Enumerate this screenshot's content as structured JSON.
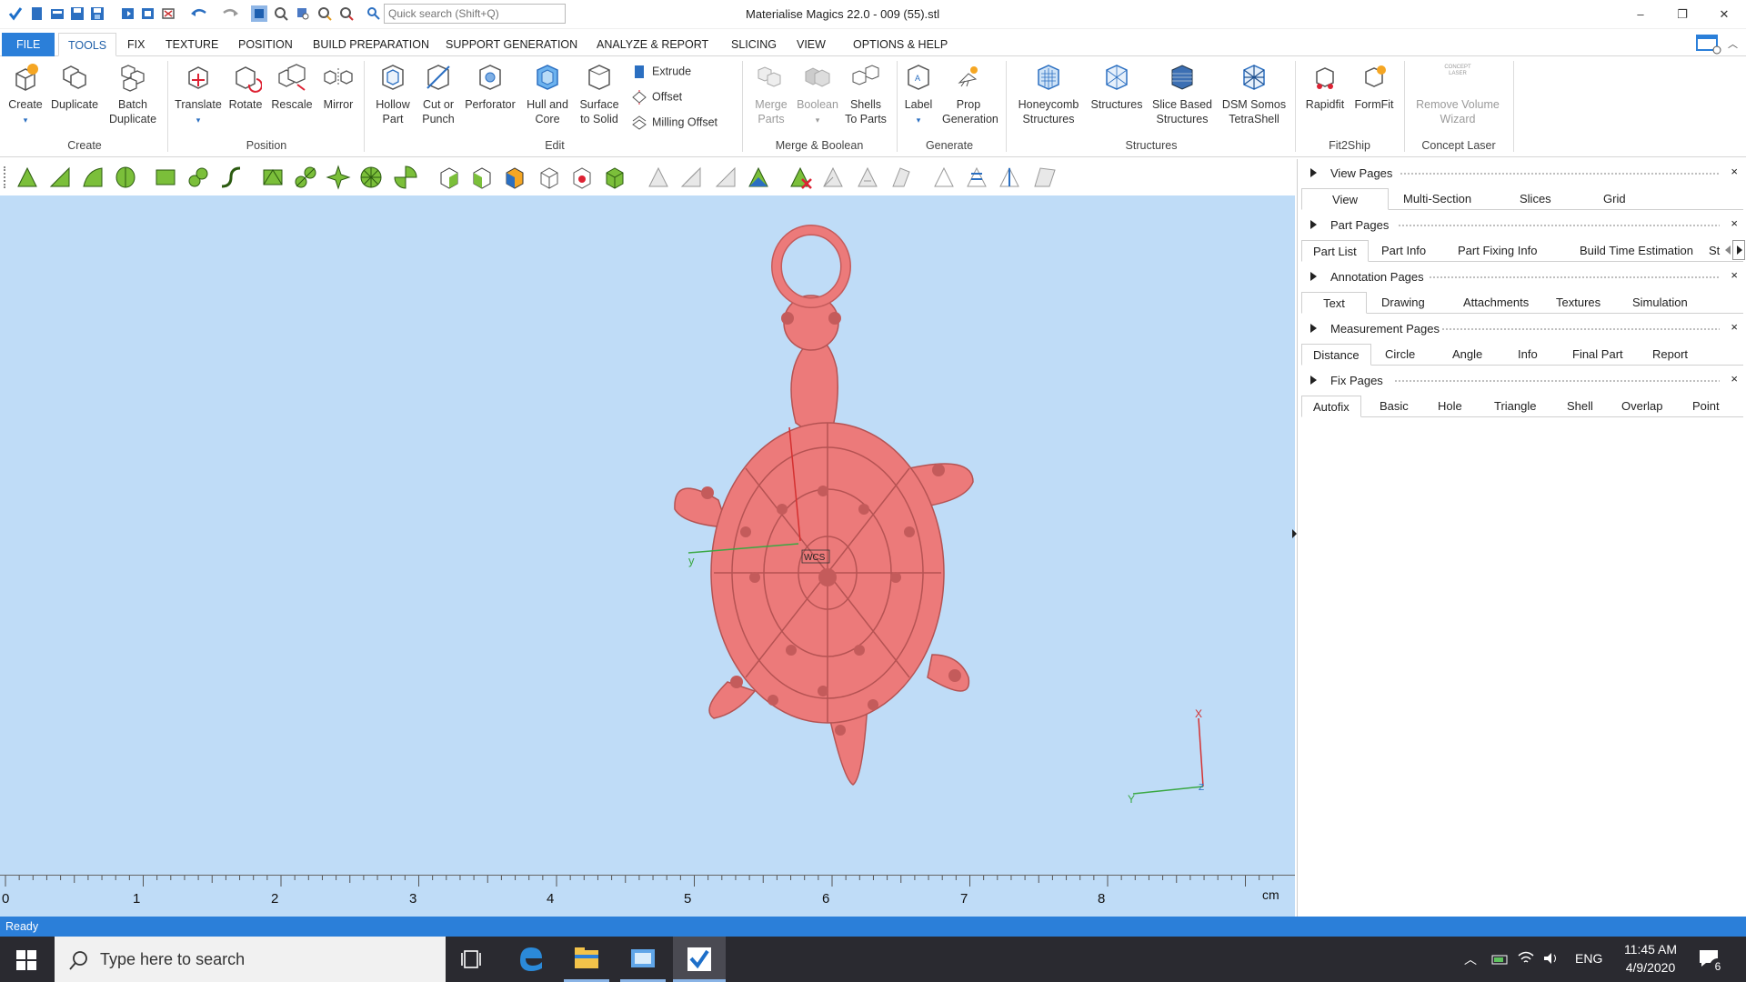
{
  "titlebar": {
    "quick_search_placeholder": "Quick search (Shift+Q)",
    "window_title": "Materialise Magics 22.0 - 009 (55).stl",
    "minimize": "–",
    "restore": "❐",
    "close": "✕"
  },
  "menu": {
    "file": "FILE",
    "tools": "TOOLS",
    "fix": "FIX",
    "texture": "TEXTURE",
    "position": "POSITION",
    "build_preparation": "BUILD PREPARATION",
    "support_generation": "SUPPORT GENERATION",
    "analyze_report": "ANALYZE & REPORT",
    "slicing": "SLICING",
    "view": "VIEW",
    "options_help": "OPTIONS & HELP"
  },
  "ribbon": {
    "create": {
      "b1": "Create",
      "b2": "Duplicate",
      "b3a": "Batch",
      "b3b": "Duplicate",
      "label": "Create"
    },
    "position": {
      "b1": "Translate",
      "b2": "Rotate",
      "b3": "Rescale",
      "b4": "Mirror",
      "label": "Position"
    },
    "edit": {
      "b1a": "Hollow",
      "b1b": "Part",
      "b2a": "Cut or",
      "b2b": "Punch",
      "b3": "Perforator",
      "b4a": "Hull and",
      "b4b": "Core",
      "b5a": "Surface",
      "b5b": "to Solid",
      "s1": "Extrude",
      "s2": "Offset",
      "s3": "Milling Offset",
      "label": "Edit"
    },
    "merge": {
      "b1a": "Merge",
      "b1b": "Parts",
      "b2": "Boolean",
      "b3a": "Shells",
      "b3b": "To Parts",
      "label": "Merge & Boolean"
    },
    "generate": {
      "b1": "Label",
      "b2a": "Prop",
      "b2b": "Generation",
      "label": "Generate"
    },
    "structures": {
      "b1a": "Honeycomb",
      "b1b": "Structures",
      "b2": "Structures",
      "b3a": "Slice Based",
      "b3b": "Structures",
      "b4a": "DSM Somos",
      "b4b": "TetraShell",
      "label": "Structures"
    },
    "fit2ship": {
      "b1": "Rapidfit",
      "b2": "FormFit",
      "label": "Fit2Ship"
    },
    "concept": {
      "b1a": "Remove Volume",
      "b1b": "Wizard",
      "label": "Concept Laser",
      "icon_text": "CONCEPT LASER"
    }
  },
  "viewport": {
    "wcs_label": "WCS",
    "axis_y": "y",
    "axis_x2": "X",
    "axis_y2": "Y",
    "axis_z2": "Z",
    "ruler": [
      "0",
      "1",
      "2",
      "3",
      "4",
      "5",
      "6",
      "7",
      "8"
    ],
    "ruler_unit": "cm",
    "model_color": "#ec7a7a",
    "background_color": "#bfdcf7"
  },
  "panels": {
    "view": {
      "title": "View Pages",
      "tabs": [
        "View",
        "Multi-Section",
        "Slices",
        "Grid"
      ]
    },
    "part": {
      "title": "Part Pages",
      "tabs": [
        "Part List",
        "Part Info",
        "Part Fixing Info",
        "Build Time Estimation",
        "St"
      ]
    },
    "annotation": {
      "title": "Annotation Pages",
      "tabs": [
        "Text",
        "Drawing",
        "Attachments",
        "Textures",
        "Simulation"
      ]
    },
    "measurement": {
      "title": "Measurement Pages",
      "tabs": [
        "Distance",
        "Circle",
        "Angle",
        "Info",
        "Final Part",
        "Report"
      ]
    },
    "fix": {
      "title": "Fix Pages",
      "tabs": [
        "Autofix",
        "Basic",
        "Hole",
        "Triangle",
        "Shell",
        "Overlap",
        "Point"
      ]
    },
    "close": "×"
  },
  "status": {
    "text": "Ready"
  },
  "taskbar": {
    "search_text": "Type here to search",
    "lang": "ENG",
    "time": "11:45 AM",
    "date": "4/9/2020",
    "notifications": "6"
  }
}
